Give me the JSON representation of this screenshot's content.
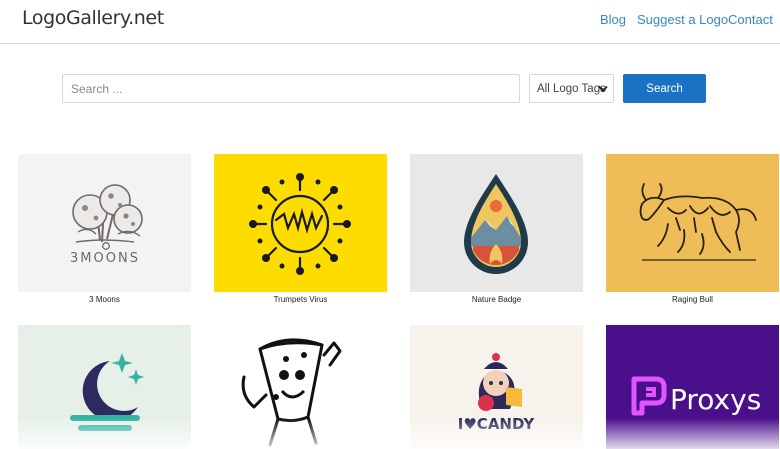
{
  "site": {
    "logo_text": "LogoGallery.net"
  },
  "nav": {
    "items": [
      {
        "label": "Blog"
      },
      {
        "label": "Suggest a Logo"
      },
      {
        "label": "Contact"
      }
    ]
  },
  "search": {
    "placeholder": "Search ...",
    "value": "",
    "tags_selected": "All Logo Tags",
    "button_label": "Search"
  },
  "gallery": {
    "items": [
      {
        "caption": "3 Moons",
        "logo_text": "3MOONS",
        "background": "#f3f3f5"
      },
      {
        "caption": "Trumpets Virus",
        "background": "#fddc00"
      },
      {
        "caption": "Nature Badge",
        "background": "#e8e8e8"
      },
      {
        "caption": "Raging Bull",
        "background": "#efbd57"
      },
      {
        "caption": "",
        "background": "#e6f0e8"
      },
      {
        "caption": "",
        "background": "#ffffff"
      },
      {
        "caption": "",
        "logo_text": "I♥CANDY",
        "background": "#f7f2ec"
      },
      {
        "caption": "",
        "logo_text": "Proxys",
        "background": "#4a0f8a"
      }
    ]
  },
  "colors": {
    "link": "#3a85c8",
    "primary_button": "#1b72c4"
  }
}
